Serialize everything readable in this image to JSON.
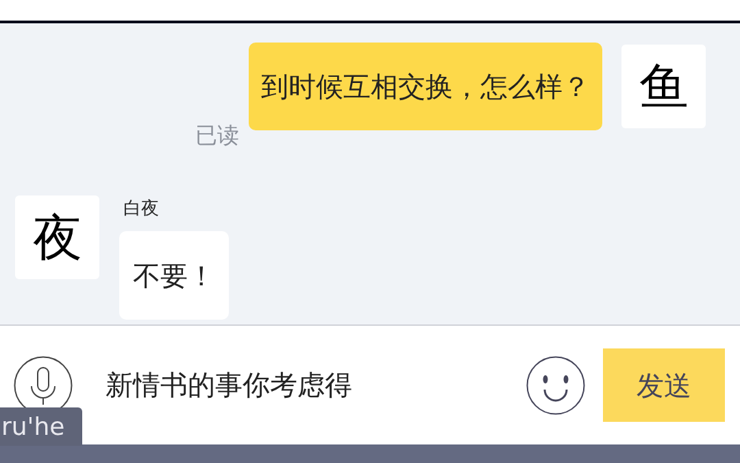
{
  "messages": [
    {
      "kind": "outgoing",
      "status": "已读",
      "text": "到时候互相交换，怎么样？",
      "avatar": "鱼"
    },
    {
      "kind": "incoming",
      "sender": "白夜",
      "text": "不要！",
      "avatar": "夜"
    }
  ],
  "composer": {
    "value": "新情书的事你考虑得",
    "send_label": "发送"
  },
  "ime": {
    "composition": "ru'he"
  }
}
